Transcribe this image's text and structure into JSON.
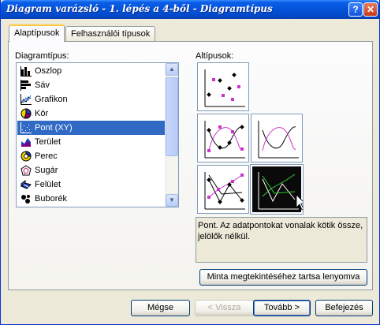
{
  "window": {
    "title": "Diagram varázsló - 1. lépés a 4-ből - Diagramtípus"
  },
  "title_buttons": {
    "help": "?",
    "close": "✕"
  },
  "tabs": [
    {
      "label": "Alaptípusok",
      "active": true
    },
    {
      "label": "Felhasználói típusok",
      "active": false
    }
  ],
  "chart_types": {
    "label": "Diagramtípus:",
    "selected": "Pont (XY)",
    "items": [
      {
        "label": "Oszlop",
        "icon": "column-chart-icon"
      },
      {
        "label": "Sáv",
        "icon": "bar-chart-icon"
      },
      {
        "label": "Grafikon",
        "icon": "line-chart-icon"
      },
      {
        "label": "Kör",
        "icon": "pie-chart-icon"
      },
      {
        "label": "Pont (XY)",
        "icon": "scatter-chart-icon"
      },
      {
        "label": "Terület",
        "icon": "area-chart-icon"
      },
      {
        "label": "Perec",
        "icon": "doughnut-chart-icon"
      },
      {
        "label": "Sugár",
        "icon": "radar-chart-icon"
      },
      {
        "label": "Felület",
        "icon": "surface-chart-icon"
      },
      {
        "label": "Buborék",
        "icon": "bubble-chart-icon"
      }
    ]
  },
  "subtypes": {
    "label": "Altípusok:",
    "selected_index": 4,
    "items": [
      {
        "name": "scatter-markers-only"
      },
      {
        "name": "scatter-smoothed-lines-markers"
      },
      {
        "name": "scatter-smoothed-lines"
      },
      {
        "name": "scatter-straight-lines-markers"
      },
      {
        "name": "scatter-straight-lines"
      }
    ]
  },
  "description": "Pont. Az adatpontokat vonalak kötik össze, jelölők nélkül.",
  "preview_button": "Minta megtekintéséhez tartsa lenyomva",
  "footer": {
    "cancel": "Mégse",
    "back": "< Vissza",
    "next": "Tovább >",
    "finish": "Befejezés"
  },
  "colors": {
    "accent": "#316ac5",
    "title_bar": "#0553d8",
    "marker_magenta": "#cc33cc",
    "series_green": "#33cc33"
  }
}
